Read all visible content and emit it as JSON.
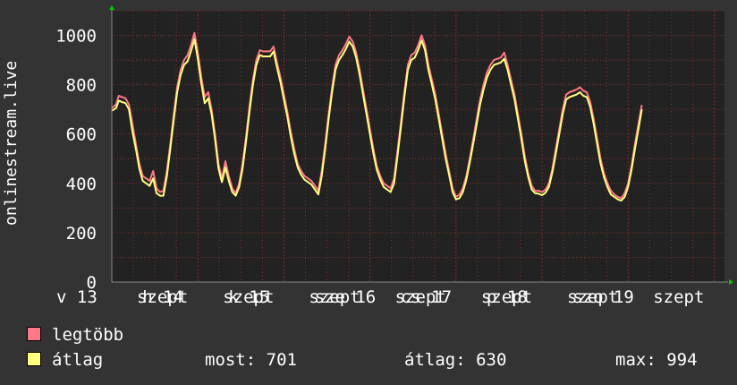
{
  "chart_data": {
    "type": "line",
    "ylabel": "onlinestream.live",
    "ylim": [
      0,
      1100
    ],
    "yticks": [
      0,
      200,
      400,
      600,
      800,
      1000
    ],
    "grid": true,
    "x_ticks": [
      "v 13 szept",
      "h 14 szept",
      "k 15 szept",
      "sze 16 szept",
      "cs 17 szept",
      "p 18 szept",
      "szo 19 szept"
    ],
    "x_tick_labels_visible": [
      "v 13",
      "szept",
      "h 14",
      "szept",
      "k 15",
      "szept",
      "sze 16",
      "szept",
      "cs 17",
      "szept",
      "p 18",
      "szept",
      "szo 19",
      "szept"
    ],
    "x_domain_days": [
      0,
      7.12
    ],
    "series": [
      {
        "name": "legtöbb",
        "color": "#ff7a85",
        "points": [
          [
            0.0,
            705
          ],
          [
            0.05,
            720
          ],
          [
            0.08,
            755
          ],
          [
            0.12,
            750
          ],
          [
            0.16,
            745
          ],
          [
            0.2,
            720
          ],
          [
            0.24,
            640
          ],
          [
            0.28,
            560
          ],
          [
            0.32,
            480
          ],
          [
            0.36,
            430
          ],
          [
            0.4,
            420
          ],
          [
            0.44,
            410
          ],
          [
            0.48,
            450
          ],
          [
            0.52,
            380
          ],
          [
            0.56,
            365
          ],
          [
            0.6,
            370
          ],
          [
            0.64,
            450
          ],
          [
            0.68,
            560
          ],
          [
            0.72,
            680
          ],
          [
            0.76,
            790
          ],
          [
            0.8,
            860
          ],
          [
            0.84,
            900
          ],
          [
            0.88,
            920
          ],
          [
            0.92,
            960
          ],
          [
            0.96,
            1010
          ],
          [
            1.0,
            930
          ],
          [
            1.04,
            830
          ],
          [
            1.08,
            750
          ],
          [
            1.12,
            770
          ],
          [
            1.16,
            700
          ],
          [
            1.2,
            600
          ],
          [
            1.24,
            480
          ],
          [
            1.28,
            420
          ],
          [
            1.32,
            490
          ],
          [
            1.36,
            430
          ],
          [
            1.4,
            380
          ],
          [
            1.44,
            360
          ],
          [
            1.48,
            400
          ],
          [
            1.52,
            480
          ],
          [
            1.56,
            590
          ],
          [
            1.6,
            710
          ],
          [
            1.64,
            820
          ],
          [
            1.68,
            900
          ],
          [
            1.72,
            940
          ],
          [
            1.76,
            935
          ],
          [
            1.8,
            935
          ],
          [
            1.84,
            935
          ],
          [
            1.88,
            955
          ],
          [
            1.92,
            890
          ],
          [
            1.96,
            830
          ],
          [
            2.0,
            760
          ],
          [
            2.04,
            690
          ],
          [
            2.08,
            610
          ],
          [
            2.12,
            540
          ],
          [
            2.16,
            480
          ],
          [
            2.2,
            450
          ],
          [
            2.24,
            430
          ],
          [
            2.28,
            420
          ],
          [
            2.32,
            410
          ],
          [
            2.36,
            390
          ],
          [
            2.4,
            370
          ],
          [
            2.44,
            450
          ],
          [
            2.48,
            560
          ],
          [
            2.52,
            680
          ],
          [
            2.56,
            790
          ],
          [
            2.6,
            880
          ],
          [
            2.64,
            920
          ],
          [
            2.68,
            940
          ],
          [
            2.72,
            965
          ],
          [
            2.76,
            995
          ],
          [
            2.8,
            975
          ],
          [
            2.84,
            930
          ],
          [
            2.88,
            860
          ],
          [
            2.92,
            780
          ],
          [
            2.96,
            700
          ],
          [
            3.0,
            620
          ],
          [
            3.04,
            540
          ],
          [
            3.08,
            470
          ],
          [
            3.12,
            430
          ],
          [
            3.16,
            400
          ],
          [
            3.2,
            390
          ],
          [
            3.24,
            380
          ],
          [
            3.28,
            420
          ],
          [
            3.32,
            530
          ],
          [
            3.36,
            650
          ],
          [
            3.4,
            770
          ],
          [
            3.44,
            880
          ],
          [
            3.48,
            920
          ],
          [
            3.52,
            930
          ],
          [
            3.56,
            960
          ],
          [
            3.6,
            1000
          ],
          [
            3.64,
            960
          ],
          [
            3.68,
            880
          ],
          [
            3.72,
            820
          ],
          [
            3.76,
            760
          ],
          [
            3.8,
            680
          ],
          [
            3.84,
            600
          ],
          [
            3.88,
            520
          ],
          [
            3.92,
            450
          ],
          [
            3.96,
            380
          ],
          [
            4.0,
            345
          ],
          [
            4.04,
            355
          ],
          [
            4.08,
            380
          ],
          [
            4.12,
            430
          ],
          [
            4.16,
            500
          ],
          [
            4.2,
            580
          ],
          [
            4.24,
            660
          ],
          [
            4.28,
            740
          ],
          [
            4.32,
            800
          ],
          [
            4.36,
            850
          ],
          [
            4.4,
            880
          ],
          [
            4.44,
            900
          ],
          [
            4.48,
            905
          ],
          [
            4.52,
            910
          ],
          [
            4.56,
            930
          ],
          [
            4.6,
            880
          ],
          [
            4.64,
            820
          ],
          [
            4.68,
            760
          ],
          [
            4.72,
            680
          ],
          [
            4.76,
            600
          ],
          [
            4.8,
            510
          ],
          [
            4.84,
            440
          ],
          [
            4.88,
            390
          ],
          [
            4.92,
            370
          ],
          [
            4.96,
            370
          ],
          [
            5.0,
            365
          ],
          [
            5.04,
            375
          ],
          [
            5.08,
            400
          ],
          [
            5.12,
            460
          ],
          [
            5.16,
            540
          ],
          [
            5.2,
            620
          ],
          [
            5.24,
            700
          ],
          [
            5.28,
            760
          ],
          [
            5.32,
            770
          ],
          [
            5.36,
            775
          ],
          [
            5.4,
            780
          ],
          [
            5.44,
            790
          ],
          [
            5.48,
            775
          ],
          [
            5.52,
            770
          ],
          [
            5.56,
            730
          ],
          [
            5.6,
            660
          ],
          [
            5.64,
            580
          ],
          [
            5.68,
            500
          ],
          [
            5.72,
            440
          ],
          [
            5.76,
            400
          ],
          [
            5.8,
            370
          ],
          [
            5.84,
            355
          ],
          [
            5.88,
            345
          ],
          [
            5.92,
            340
          ],
          [
            5.96,
            360
          ],
          [
            6.0,
            400
          ],
          [
            6.04,
            470
          ],
          [
            6.08,
            560
          ],
          [
            6.12,
            640
          ],
          [
            6.16,
            718
          ]
        ]
      },
      {
        "name": "átlag",
        "color": "#ffff80",
        "points": [
          [
            0.0,
            695
          ],
          [
            0.05,
            705
          ],
          [
            0.08,
            735
          ],
          [
            0.12,
            730
          ],
          [
            0.16,
            725
          ],
          [
            0.2,
            700
          ],
          [
            0.24,
            610
          ],
          [
            0.28,
            540
          ],
          [
            0.32,
            460
          ],
          [
            0.36,
            410
          ],
          [
            0.4,
            400
          ],
          [
            0.44,
            390
          ],
          [
            0.48,
            420
          ],
          [
            0.52,
            360
          ],
          [
            0.56,
            350
          ],
          [
            0.6,
            350
          ],
          [
            0.64,
            430
          ],
          [
            0.68,
            540
          ],
          [
            0.72,
            660
          ],
          [
            0.76,
            770
          ],
          [
            0.8,
            840
          ],
          [
            0.84,
            880
          ],
          [
            0.88,
            895
          ],
          [
            0.92,
            935
          ],
          [
            0.96,
            985
          ],
          [
            1.0,
            905
          ],
          [
            1.04,
            805
          ],
          [
            1.08,
            725
          ],
          [
            1.12,
            745
          ],
          [
            1.16,
            680
          ],
          [
            1.2,
            580
          ],
          [
            1.24,
            460
          ],
          [
            1.28,
            405
          ],
          [
            1.32,
            465
          ],
          [
            1.36,
            410
          ],
          [
            1.4,
            365
          ],
          [
            1.44,
            350
          ],
          [
            1.48,
            385
          ],
          [
            1.52,
            460
          ],
          [
            1.56,
            570
          ],
          [
            1.6,
            690
          ],
          [
            1.64,
            800
          ],
          [
            1.68,
            880
          ],
          [
            1.72,
            920
          ],
          [
            1.76,
            915
          ],
          [
            1.8,
            915
          ],
          [
            1.84,
            915
          ],
          [
            1.88,
            935
          ],
          [
            1.92,
            870
          ],
          [
            1.96,
            810
          ],
          [
            2.0,
            740
          ],
          [
            2.04,
            670
          ],
          [
            2.08,
            590
          ],
          [
            2.12,
            520
          ],
          [
            2.16,
            465
          ],
          [
            2.2,
            435
          ],
          [
            2.24,
            415
          ],
          [
            2.28,
            405
          ],
          [
            2.32,
            395
          ],
          [
            2.36,
            375
          ],
          [
            2.4,
            355
          ],
          [
            2.44,
            430
          ],
          [
            2.48,
            540
          ],
          [
            2.52,
            660
          ],
          [
            2.56,
            770
          ],
          [
            2.6,
            860
          ],
          [
            2.64,
            900
          ],
          [
            2.68,
            920
          ],
          [
            2.72,
            945
          ],
          [
            2.76,
            975
          ],
          [
            2.8,
            955
          ],
          [
            2.84,
            910
          ],
          [
            2.88,
            840
          ],
          [
            2.92,
            760
          ],
          [
            2.96,
            680
          ],
          [
            3.0,
            600
          ],
          [
            3.04,
            520
          ],
          [
            3.08,
            455
          ],
          [
            3.12,
            415
          ],
          [
            3.16,
            385
          ],
          [
            3.2,
            375
          ],
          [
            3.24,
            365
          ],
          [
            3.28,
            400
          ],
          [
            3.32,
            510
          ],
          [
            3.36,
            630
          ],
          [
            3.4,
            750
          ],
          [
            3.44,
            860
          ],
          [
            3.48,
            900
          ],
          [
            3.52,
            910
          ],
          [
            3.56,
            940
          ],
          [
            3.6,
            980
          ],
          [
            3.64,
            940
          ],
          [
            3.68,
            860
          ],
          [
            3.72,
            800
          ],
          [
            3.76,
            740
          ],
          [
            3.8,
            660
          ],
          [
            3.84,
            580
          ],
          [
            3.88,
            500
          ],
          [
            3.92,
            435
          ],
          [
            3.96,
            365
          ],
          [
            4.0,
            335
          ],
          [
            4.04,
            340
          ],
          [
            4.08,
            365
          ],
          [
            4.12,
            415
          ],
          [
            4.16,
            485
          ],
          [
            4.2,
            560
          ],
          [
            4.24,
            640
          ],
          [
            4.28,
            720
          ],
          [
            4.32,
            780
          ],
          [
            4.36,
            830
          ],
          [
            4.4,
            860
          ],
          [
            4.44,
            880
          ],
          [
            4.48,
            885
          ],
          [
            4.52,
            890
          ],
          [
            4.56,
            905
          ],
          [
            4.6,
            860
          ],
          [
            4.64,
            800
          ],
          [
            4.68,
            740
          ],
          [
            4.72,
            660
          ],
          [
            4.76,
            580
          ],
          [
            4.8,
            490
          ],
          [
            4.84,
            425
          ],
          [
            4.88,
            375
          ],
          [
            4.92,
            360
          ],
          [
            4.96,
            358
          ],
          [
            5.0,
            352
          ],
          [
            5.04,
            362
          ],
          [
            5.08,
            385
          ],
          [
            5.12,
            445
          ],
          [
            5.16,
            520
          ],
          [
            5.2,
            600
          ],
          [
            5.24,
            680
          ],
          [
            5.28,
            740
          ],
          [
            5.32,
            750
          ],
          [
            5.36,
            755
          ],
          [
            5.4,
            760
          ],
          [
            5.44,
            770
          ],
          [
            5.48,
            755
          ],
          [
            5.52,
            750
          ],
          [
            5.56,
            710
          ],
          [
            5.6,
            640
          ],
          [
            5.64,
            560
          ],
          [
            5.68,
            480
          ],
          [
            5.72,
            425
          ],
          [
            5.76,
            385
          ],
          [
            5.8,
            355
          ],
          [
            5.84,
            345
          ],
          [
            5.88,
            335
          ],
          [
            5.92,
            330
          ],
          [
            5.96,
            345
          ],
          [
            6.0,
            385
          ],
          [
            6.04,
            455
          ],
          [
            6.08,
            540
          ],
          [
            6.12,
            620
          ],
          [
            6.16,
            700
          ]
        ]
      }
    ]
  },
  "legend": [
    {
      "label": "legtöbb",
      "color": "#ff7a85"
    },
    {
      "label": "átlag",
      "color": "#ffff80"
    }
  ],
  "stats": {
    "most": "most: 701",
    "atlag": "átlag: 630",
    "max": "max: 994"
  },
  "colors": {
    "background": "#333333",
    "plot_background": "#222222",
    "grid": "#7a2f2f",
    "axis": "#888888",
    "arrow": "#00cc00"
  }
}
